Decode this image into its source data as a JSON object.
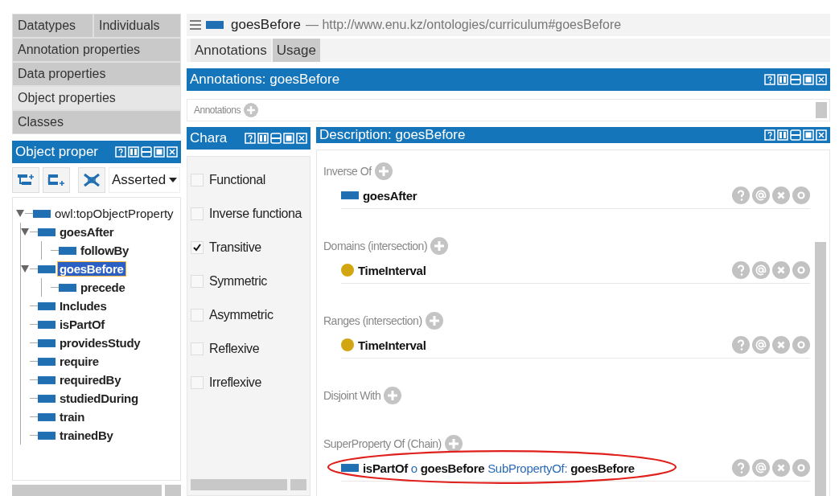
{
  "left_tabs": {
    "rows": [
      {
        "tabs": [
          {
            "label": "Datatypes",
            "selected": false
          },
          {
            "label": "Individuals",
            "selected": false
          }
        ]
      },
      {
        "tabs": [
          {
            "label": "Annotation properties",
            "selected": false
          }
        ]
      },
      {
        "tabs": [
          {
            "label": "Data properties",
            "selected": false
          }
        ]
      },
      {
        "tabs": [
          {
            "label": "Object properties",
            "selected": true
          }
        ]
      },
      {
        "tabs": [
          {
            "label": "Classes",
            "selected": false
          }
        ]
      }
    ]
  },
  "hierarchy_panel": {
    "title": "Object proper",
    "dropdown": "Asserted",
    "tree": [
      {
        "label": "owl:topObjectProperty",
        "bold": false,
        "selected": false,
        "expanded": true,
        "children": [
          {
            "label": "goesAfter",
            "bold": true,
            "selected": false,
            "expanded": true,
            "children": [
              {
                "label": "followBy",
                "bold": true,
                "selected": false
              }
            ]
          },
          {
            "label": "goesBefore",
            "bold": true,
            "selected": true,
            "expanded": true,
            "children": [
              {
                "label": "precede",
                "bold": true,
                "selected": false
              }
            ]
          },
          {
            "label": "Includes",
            "bold": true,
            "selected": false
          },
          {
            "label": "isPartOf",
            "bold": true,
            "selected": false
          },
          {
            "label": "providesStudy",
            "bold": true,
            "selected": false
          },
          {
            "label": "require",
            "bold": true,
            "selected": false
          },
          {
            "label": "requiredBy",
            "bold": true,
            "selected": false
          },
          {
            "label": "studiedDuring",
            "bold": true,
            "selected": false
          },
          {
            "label": "train",
            "bold": true,
            "selected": false
          },
          {
            "label": "trainedBy",
            "bold": true,
            "selected": false
          }
        ]
      }
    ]
  },
  "entity_header": {
    "title": "goesBefore",
    "iri": "— http://www.enu.kz/ontologies/curriculum#goesBefore"
  },
  "tabs": [
    {
      "label": "Annotations",
      "selected": true
    },
    {
      "label": "Usage",
      "selected": false
    }
  ],
  "annotations_panel": {
    "title": "Annotations: goesBefore",
    "section_label": "Annotations"
  },
  "characteristics_panel": {
    "title": "Chara",
    "items": [
      {
        "label": "Functional",
        "checked": false
      },
      {
        "label": "Inverse functiona",
        "checked": false
      },
      {
        "label": "Transitive",
        "checked": true
      },
      {
        "label": "Symmetric",
        "checked": false
      },
      {
        "label": "Asymmetric",
        "checked": false
      },
      {
        "label": "Reflexive",
        "checked": false
      },
      {
        "label": "Irreflexive",
        "checked": false
      }
    ]
  },
  "description_panel": {
    "title": "Description: goesBefore",
    "sections": [
      {
        "label": "Inverse Of",
        "items": [
          {
            "kind": "property",
            "circled": false,
            "parts": [
              {
                "kind": "entity",
                "text": "goesAfter"
              }
            ]
          }
        ]
      },
      {
        "label": "Domains (intersection)",
        "items": [
          {
            "kind": "class",
            "circled": false,
            "parts": [
              {
                "kind": "entity",
                "text": "TimeInterval"
              }
            ]
          }
        ]
      },
      {
        "label": "Ranges (intersection)",
        "items": [
          {
            "kind": "class",
            "circled": false,
            "parts": [
              {
                "kind": "entity",
                "text": "TimeInterval"
              }
            ]
          }
        ]
      },
      {
        "label": "Disjoint With"
      },
      {
        "label": "SuperProperty Of (Chain)",
        "items": [
          {
            "kind": "property",
            "circled": true,
            "parts": [
              {
                "kind": "entity",
                "text": "isPartOf"
              },
              {
                "kind": "keyword",
                "text": "o"
              },
              {
                "kind": "entity",
                "text": "goesBefore"
              },
              {
                "kind": "keyword",
                "text": "SubPropertyOf:"
              },
              {
                "kind": "entity",
                "text": "goesBefore"
              }
            ]
          }
        ]
      }
    ]
  }
}
